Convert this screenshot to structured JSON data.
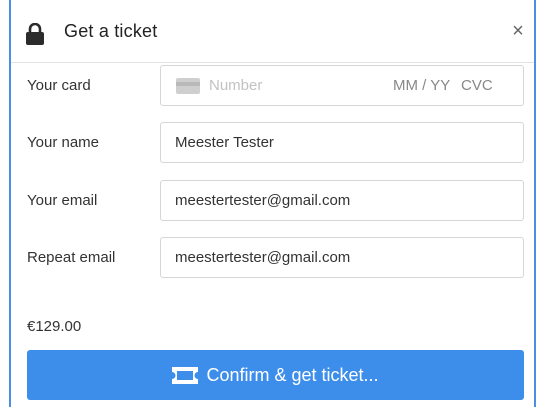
{
  "header": {
    "title": "Get a ticket",
    "close_label": "×",
    "lock_icon": "lock-icon"
  },
  "form": {
    "card": {
      "label": "Your card",
      "number_placeholder": "Number",
      "expiry_placeholder": "MM / YY",
      "cvc_placeholder": "CVC"
    },
    "name": {
      "label": "Your name",
      "value": "Meester Tester"
    },
    "email": {
      "label": "Your email",
      "value": "meestertester@gmail.com"
    },
    "repeat_email": {
      "label": "Repeat email",
      "value": "meestertester@gmail.com"
    }
  },
  "price": "€129.00",
  "confirm": {
    "label": "Confirm & get ticket..."
  },
  "colors": {
    "accent": "#3d8eea",
    "frame": "#4a90e2"
  }
}
